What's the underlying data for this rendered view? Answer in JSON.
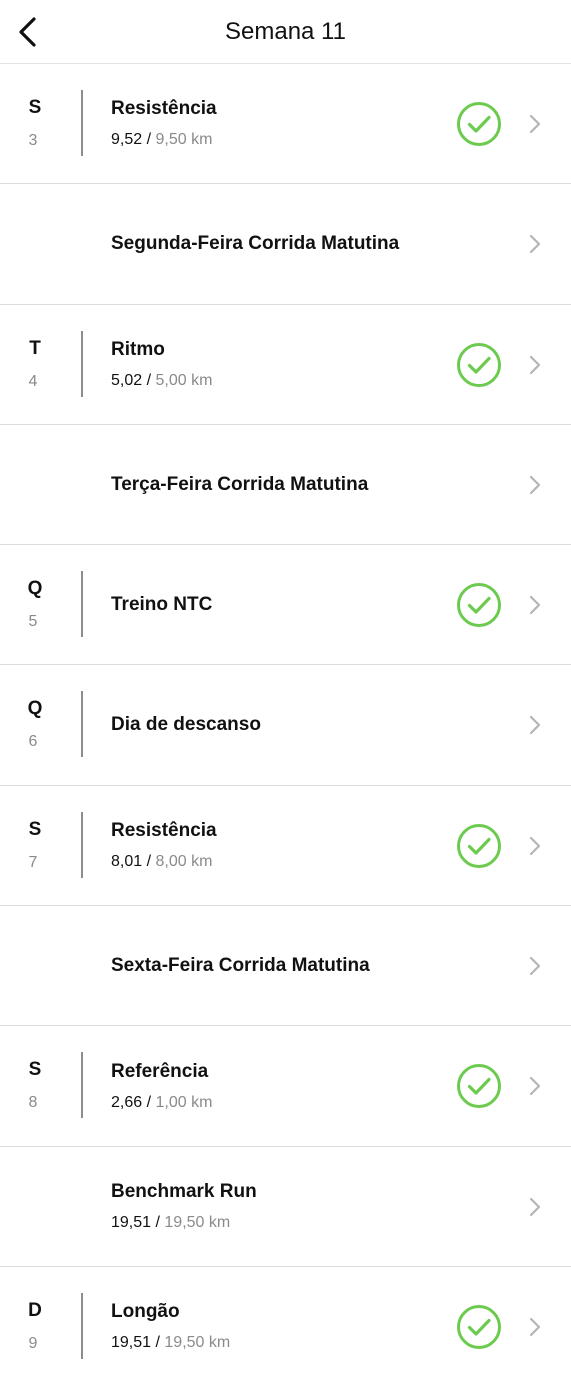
{
  "header": {
    "title": "Semana 11",
    "back_icon": "chevron-left-icon"
  },
  "colors": {
    "check": "#6ccb4e",
    "divider": "#8d8d8d",
    "muted": "#8a8a8a",
    "chevron": "#b5b5b5"
  },
  "rows": [
    {
      "day": "S",
      "num": "3",
      "name": "Resistência",
      "actual": "9,52",
      "sep": " / ",
      "target": "9,50 km",
      "done": true
    },
    {
      "day": "",
      "num": "",
      "name": "Segunda-Feira Corrida Matutina",
      "actual": "",
      "sep": "",
      "target": "",
      "done": false
    },
    {
      "day": "T",
      "num": "4",
      "name": "Ritmo",
      "actual": "5,02",
      "sep": " / ",
      "target": "5,00 km",
      "done": true
    },
    {
      "day": "",
      "num": "",
      "name": "Terça-Feira Corrida Matutina",
      "actual": "",
      "sep": "",
      "target": "",
      "done": false
    },
    {
      "day": "Q",
      "num": "5",
      "name": "Treino NTC",
      "actual": "",
      "sep": "",
      "target": "",
      "done": true
    },
    {
      "day": "Q",
      "num": "6",
      "name": "Dia de descanso",
      "actual": "",
      "sep": "",
      "target": "",
      "done": false
    },
    {
      "day": "S",
      "num": "7",
      "name": "Resistência",
      "actual": "8,01",
      "sep": " / ",
      "target": "8,00 km",
      "done": true
    },
    {
      "day": "",
      "num": "",
      "name": "Sexta-Feira Corrida Matutina",
      "actual": "",
      "sep": "",
      "target": "",
      "done": false
    },
    {
      "day": "S",
      "num": "8",
      "name": "Referência",
      "actual": "2,66",
      "sep": " / ",
      "target": "1,00 km",
      "done": true
    },
    {
      "day": "",
      "num": "",
      "name": "Benchmark Run",
      "actual": "19,51",
      "sep": " / ",
      "target": "19,50 km",
      "done": false
    },
    {
      "day": "D",
      "num": "9",
      "name": "Longão",
      "actual": "19,51",
      "sep": " / ",
      "target": "19,50 km",
      "done": true
    }
  ]
}
